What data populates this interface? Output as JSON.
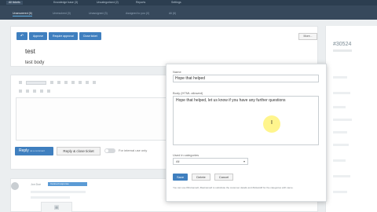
{
  "topnav": {
    "items": [
      "All tickets",
      "Knowledge base (3)",
      "Uncategorised (2)",
      "Reports",
      "Settings"
    ]
  },
  "subnav": {
    "tabs": [
      "Unanswered (6)",
      "Unresolved (0)",
      "Unassigned (3)",
      "Assigned to you (0)",
      "All (6)"
    ]
  },
  "ticket": {
    "toolbar": {
      "back_icon": "arrow-icon",
      "approve_label": "Approve",
      "require_approval_label": "Require approval",
      "close_label": "Close ticket"
    },
    "more_label": "More...",
    "title": "test",
    "body": "test body"
  },
  "reply": {
    "format_label": "Paragraph",
    "reply_label": "Reply",
    "reply_sub": "as a comment",
    "reply_close_label": "Reply & close ticket",
    "internal_label": "For internal use only"
  },
  "preview": {
    "name": "Jon Doe",
    "badge": "Canned response"
  },
  "sidebar": {
    "ticket_id": "#30524"
  },
  "dialog": {
    "name_label": "Name",
    "name_value": "Hope that helped",
    "body_label": "Body (HTML allowed)",
    "body_value": "Hope that helped, let us know if you have any further questions",
    "category_label": "Used in categories",
    "category_value": "All",
    "save_label": "Save",
    "delete_label": "Delete",
    "cancel_label": "Cancel",
    "help_text": "You can use #firstname#, #lastname# to substitute the customer details and #ticketid# for the categories with name."
  }
}
